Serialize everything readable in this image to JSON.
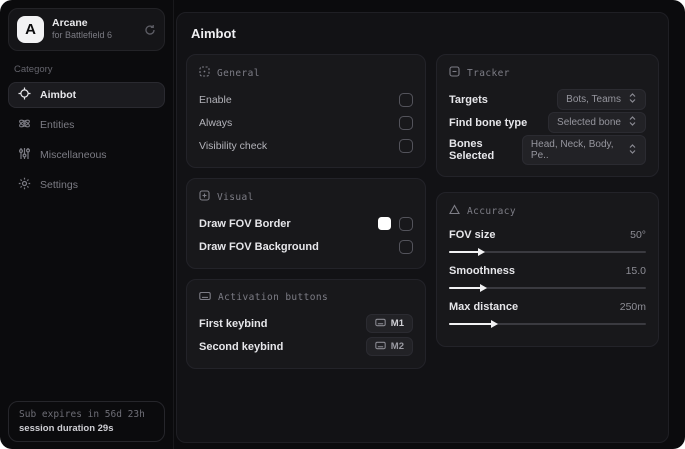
{
  "sidebar": {
    "logo_letter": "A",
    "app_name": "Arcane",
    "app_subtitle": "for Battlefield 6",
    "category_label": "Category",
    "items": [
      {
        "label": "Aimbot",
        "icon": "crosshair-icon",
        "active": true
      },
      {
        "label": "Entities",
        "icon": "atom-icon",
        "active": false
      },
      {
        "label": "Miscellaneous",
        "icon": "sliders-icon",
        "active": false
      },
      {
        "label": "Settings",
        "icon": "gear-icon",
        "active": false
      }
    ],
    "status": {
      "line1": "Sub expires in 56d 23h",
      "line2": "session duration 29s"
    }
  },
  "main": {
    "title": "Aimbot",
    "general": {
      "title": "General",
      "rows": [
        {
          "label": "Enable",
          "checked": false
        },
        {
          "label": "Always",
          "checked": false
        },
        {
          "label": "Visibility check",
          "checked": false
        }
      ]
    },
    "visual": {
      "title": "Visual",
      "rows": [
        {
          "label": "Draw FOV Border",
          "swatch_color": "#ffffff",
          "checked": false
        },
        {
          "label": "Draw FOV Background",
          "checked": false
        }
      ]
    },
    "activation": {
      "title": "Activation buttons",
      "rows": [
        {
          "label": "First keybind",
          "key": "M1"
        },
        {
          "label": "Second keybind",
          "key": "M2"
        }
      ]
    },
    "tracker": {
      "title": "Tracker",
      "rows": [
        {
          "label": "Targets",
          "value": "Bots, Teams"
        },
        {
          "label": "Find bone type",
          "value": "Selected bone"
        },
        {
          "label": "Bones Selected",
          "value": "Head, Neck, Body, Pe.."
        }
      ]
    },
    "accuracy": {
      "title": "Accuracy",
      "sliders": [
        {
          "label": "FOV size",
          "value": "50°",
          "fill": "15%"
        },
        {
          "label": "Smoothness",
          "value": "15.0",
          "fill": "16%"
        },
        {
          "label": "Max distance",
          "value": "250m",
          "fill": "22%"
        }
      ]
    }
  },
  "colors": {
    "window_bg": "#0b0b0d",
    "panel_bg": "#121215",
    "card_bg": "#18181b",
    "accent_swatch": "#ffffff",
    "text_bright": "#e6e6ea",
    "text_dim": "#7d7d86"
  }
}
